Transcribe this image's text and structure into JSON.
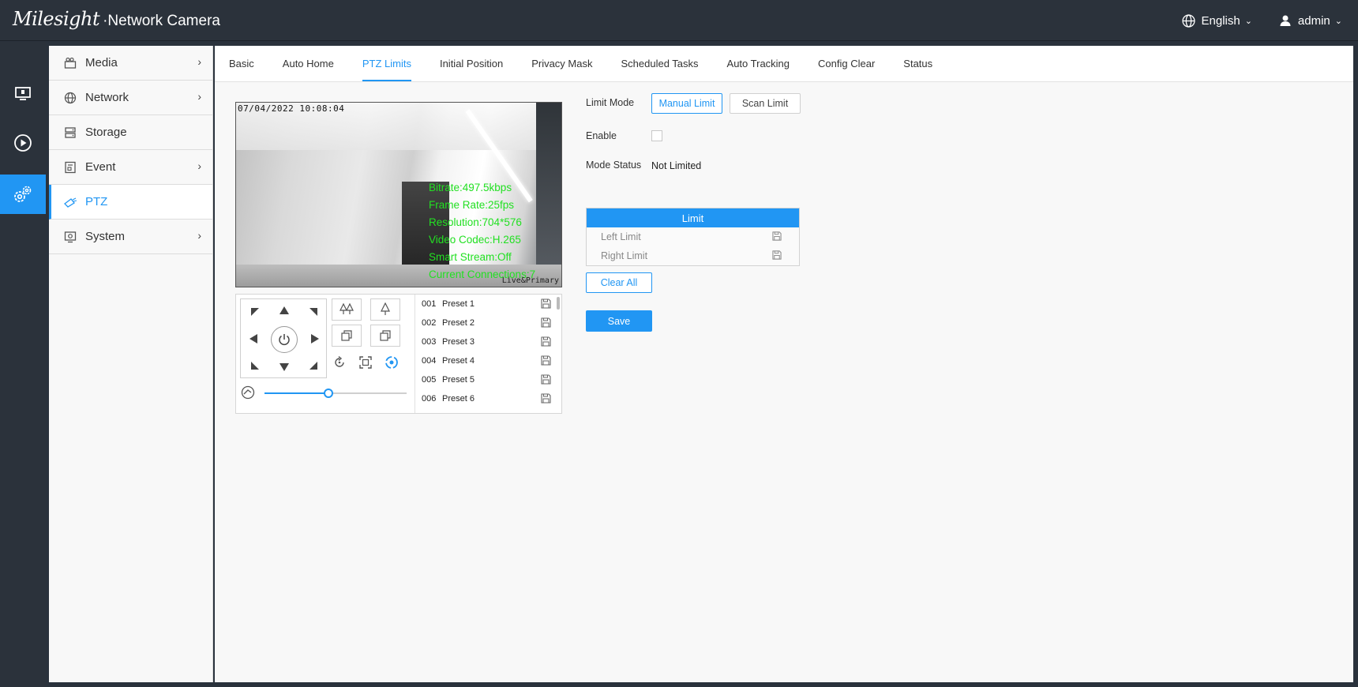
{
  "app": {
    "brand": "Milesight",
    "product": "·Network Camera"
  },
  "header": {
    "language": "English",
    "user": "admin"
  },
  "sidebar": {
    "items": [
      {
        "label": "Media",
        "icon": "media-icon",
        "has_arrow": true
      },
      {
        "label": "Network",
        "icon": "globe-icon",
        "has_arrow": true
      },
      {
        "label": "Storage",
        "icon": "storage-icon",
        "has_arrow": false
      },
      {
        "label": "Event",
        "icon": "event-icon",
        "has_arrow": true
      },
      {
        "label": "PTZ",
        "icon": "ptz-camera-icon",
        "has_arrow": false,
        "active": true
      },
      {
        "label": "System",
        "icon": "system-icon",
        "has_arrow": true
      }
    ]
  },
  "tabs": [
    "Basic",
    "Auto Home",
    "PTZ Limits",
    "Initial Position",
    "Privacy Mask",
    "Scheduled Tasks",
    "Auto Tracking",
    "Config Clear",
    "Status"
  ],
  "active_tab": "PTZ Limits",
  "video": {
    "timestamp": "07/04/2022 10:08:04",
    "osd": [
      "Bitrate:497.5kbps",
      "Frame Rate:25fps",
      "Resolution:704*576",
      "Video Codec:H.265",
      "Smart Stream:Off",
      "Current Connections:7"
    ],
    "stream_label": "Live&Primary"
  },
  "ptz": {
    "speed_fraction": 0.45,
    "presets": [
      {
        "num": "001",
        "name": "Preset 1"
      },
      {
        "num": "002",
        "name": "Preset 2"
      },
      {
        "num": "003",
        "name": "Preset 3"
      },
      {
        "num": "004",
        "name": "Preset 4"
      },
      {
        "num": "005",
        "name": "Preset 5"
      },
      {
        "num": "006",
        "name": "Preset 6"
      }
    ]
  },
  "form": {
    "limit_mode_label": "Limit Mode",
    "manual_limit": "Manual Limit",
    "scan_limit": "Scan Limit",
    "enable_label": "Enable",
    "mode_status_label": "Mode Status",
    "mode_status_value": "Not Limited",
    "limit_header": "Limit",
    "left_limit": "Left Limit",
    "right_limit": "Right Limit",
    "clear_all": "Clear All",
    "save": "Save"
  },
  "colors": {
    "accent": "#2196f3",
    "topbar": "#2b323b",
    "osd_text": "#22e022"
  }
}
